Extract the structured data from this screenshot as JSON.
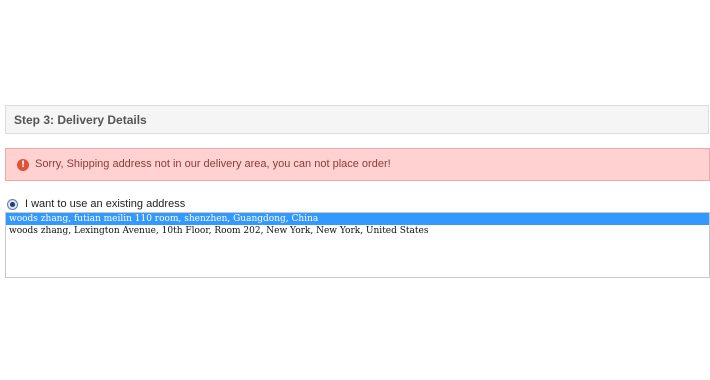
{
  "step": {
    "title": "Step 3: Delivery Details"
  },
  "alert": {
    "icon": "exclamation-circle-icon",
    "glyph": "!",
    "message": "Sorry, Shipping address not in our delivery area, you can not place order!",
    "background": "#ffd1d1"
  },
  "address_choice": {
    "label": "I want to use an existing address",
    "selected": true
  },
  "addresses": [
    {
      "text": "woods zhang, futian meilin 110 room, shenzhen, Guangdong, China",
      "selected": true
    },
    {
      "text": "woods zhang, Lexington Avenue, 10th Floor, Room 202, New York, New York, United States",
      "selected": false
    }
  ],
  "colors": {
    "selection": "#3399ff",
    "alert_icon": "#e0533b"
  }
}
